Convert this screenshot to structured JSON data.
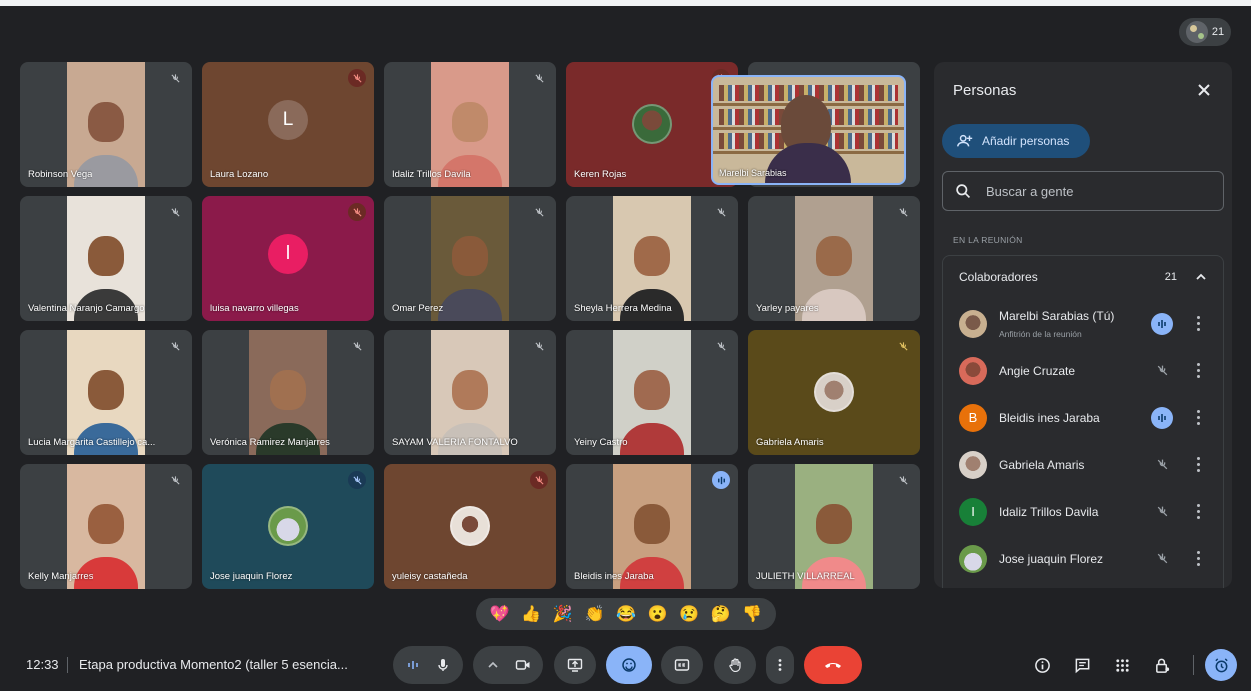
{
  "participants_count": "21",
  "grid": {
    "tiles": [
      {
        "name": "Robinson Vega",
        "mic": "muted"
      },
      {
        "name": "Laura Lozano",
        "mic": "muted-red",
        "avatar_letter": "L"
      },
      {
        "name": "Idaliz Trillos Davila",
        "mic": "muted"
      },
      {
        "name": "Keren Rojas",
        "mic": "muted-red"
      },
      {
        "name": "Valentina Naranjo Camargo",
        "mic": "muted"
      },
      {
        "name": "luisa navarro villegas",
        "mic": "muted-red",
        "avatar_letter": "l"
      },
      {
        "name": "Omar Perez",
        "mic": "muted"
      },
      {
        "name": "Sheyla Herrera Medina",
        "mic": "muted"
      },
      {
        "name": "Yarley payares",
        "mic": "muted"
      },
      {
        "name": "Lucia Margarita Castillejo ca...",
        "mic": "muted"
      },
      {
        "name": "Verónica Ramirez Manjarres",
        "mic": "muted"
      },
      {
        "name": "SAYAM VALERIA FONTALVO",
        "mic": "muted"
      },
      {
        "name": "Yeiny Castro",
        "mic": "muted"
      },
      {
        "name": "Gabriela Amaris",
        "mic": "muted"
      },
      {
        "name": "Kelly Manjarres",
        "mic": "muted"
      },
      {
        "name": "Jose juaquin Florez",
        "mic": "muted-blue"
      },
      {
        "name": "yuleisy castañeda",
        "mic": "muted-red"
      },
      {
        "name": "Bleidis ines Jaraba",
        "mic": "speaking"
      },
      {
        "name": "JULIETH VILLARREAL",
        "mic": "muted"
      }
    ],
    "pip_name": "Marelbi Sarabias"
  },
  "panel": {
    "title": "Personas",
    "add_label": "Añadir personas",
    "search_placeholder": "Buscar a gente",
    "section_label": "EN LA REUNIÓN",
    "group_label": "Colaboradores",
    "group_count": "21",
    "people": [
      {
        "name": "Marelbi Sarabias (Tú)",
        "subtitle": "Anfitrión de la reunión",
        "status": "speaking",
        "avatar": "photo"
      },
      {
        "name": "Angie Cruzate",
        "status": "muted",
        "avatar": "photo"
      },
      {
        "name": "Bleidis ines Jaraba",
        "status": "speaking",
        "avatar": "letter",
        "letter": "B",
        "color": "#e8710a"
      },
      {
        "name": "Gabriela Amaris",
        "status": "muted",
        "avatar": "photo"
      },
      {
        "name": "Idaliz Trillos Davila",
        "status": "muted",
        "avatar": "letter",
        "letter": "I",
        "color": "#188038"
      },
      {
        "name": "Jose juaquin Florez",
        "status": "muted",
        "avatar": "photo"
      }
    ]
  },
  "reactions": [
    "💖",
    "👍",
    "🎉",
    "👏",
    "😂",
    "😮",
    "😢",
    "🤔",
    "👎"
  ],
  "bottom": {
    "time": "12:33",
    "meeting_title": "Etapa productiva Momento2 (taller 5 esencia..."
  },
  "colors": {
    "background": "#202124",
    "tile": "#3c4043",
    "accent": "#8ab4f8",
    "end_call": "#ea4335"
  }
}
